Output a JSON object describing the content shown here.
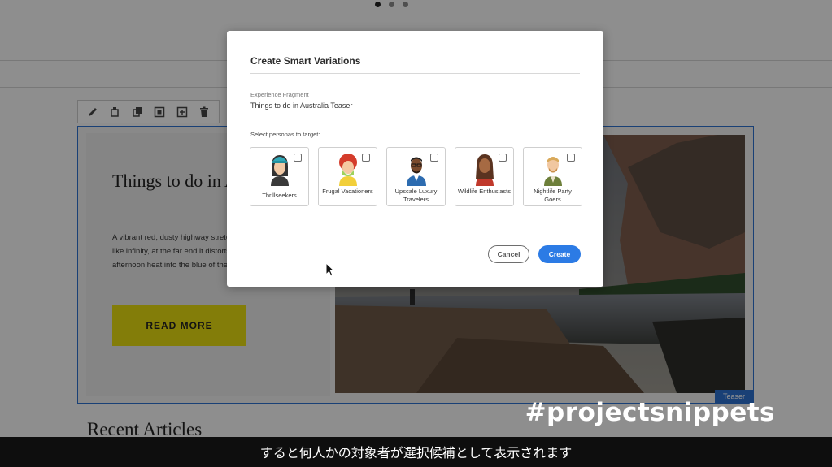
{
  "background_page": {
    "teaser": {
      "title": "Things to do in Australia",
      "body": "A vibrant red, dusty highway stretches out for what seems like infinity, at the far end it distorts and shimmers from the afternoon heat into the blue of the horizon.",
      "read_more_label": "READ MORE",
      "component_tag": "Teaser"
    },
    "recent_heading": "Recent Articles"
  },
  "modal": {
    "title": "Create Smart Variations",
    "fragment_label": "Experience Fragment",
    "fragment_value": "Things to do in Australia Teaser",
    "persona_prompt": "Select personas to target:",
    "personas": [
      {
        "label": "Thrillseekers",
        "icon": "thrillseeker-avatar-icon"
      },
      {
        "label": "Frugal Vacationers",
        "icon": "frugal-vacationer-avatar-icon"
      },
      {
        "label": "Upscale Luxury Travelers",
        "icon": "luxury-traveler-avatar-icon"
      },
      {
        "label": "Wildlife Enthusiasts",
        "icon": "wildlife-enthusiast-avatar-icon"
      },
      {
        "label": "Nightlife Party Goers",
        "icon": "nightlife-avatar-icon"
      }
    ],
    "cancel_label": "Cancel",
    "create_label": "Create"
  },
  "overlay_brand": "#projectsnippets",
  "subtitle": "すると何人かの対象者が選択候補として表示されます",
  "colors": {
    "accent": "#2c7be5",
    "read_more_bg": "#e2d711",
    "selection_border": "#2c6ecb"
  }
}
